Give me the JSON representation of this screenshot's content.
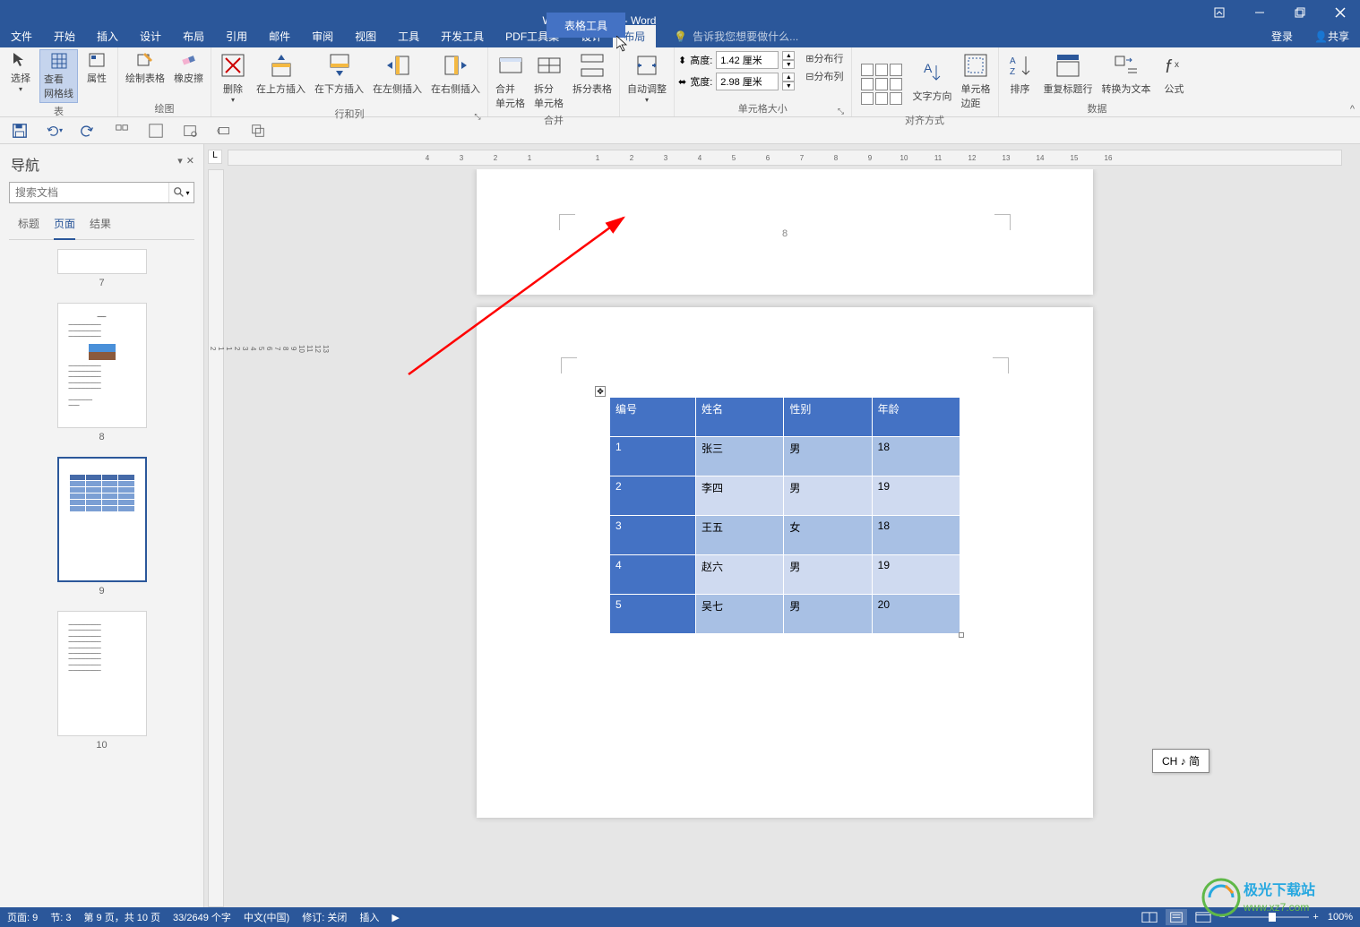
{
  "title_bar": {
    "doc_title": "Word教程2.docx - Word",
    "table_tools": "表格工具"
  },
  "window_controls": {
    "ribbon_opts": "功能区显示选项",
    "min": "最小化",
    "restore": "还原",
    "close": "关闭"
  },
  "menu": {
    "items": [
      "文件",
      "开始",
      "插入",
      "设计",
      "布局",
      "引用",
      "邮件",
      "审阅",
      "视图",
      "工具",
      "开发工具",
      "PDF工具集",
      "设计",
      "布局"
    ],
    "login": "登录",
    "share": "共享",
    "tell_me_placeholder": "告诉我您想要做什么..."
  },
  "ribbon": {
    "groups": {
      "table": {
        "label": "表",
        "select": "选择",
        "view_grid": "查看\n网格线",
        "properties": "属性"
      },
      "draw": {
        "label": "绘图",
        "draw_table": "绘制表格",
        "eraser": "橡皮擦"
      },
      "rows_cols": {
        "label": "行和列",
        "delete": "删除",
        "insert_above": "在上方插入",
        "insert_below": "在下方插入",
        "insert_left": "在左侧插入",
        "insert_right": "在右侧插入"
      },
      "merge": {
        "label": "合并",
        "merge_cells": "合并\n单元格",
        "split_cells": "拆分\n单元格",
        "split_table": "拆分表格"
      },
      "autofit": {
        "label": "",
        "autofit": "自动调整"
      },
      "cell_size": {
        "label": "单元格大小",
        "height": "高度:",
        "width": "宽度:",
        "height_val": "1.42 厘米",
        "width_val": "2.98 厘米",
        "dist_rows": "分布行",
        "dist_cols": "分布列"
      },
      "alignment": {
        "label": "对齐方式",
        "text_dir": "文字方向",
        "cell_margins": "单元格\n边距"
      },
      "data": {
        "label": "数据",
        "sort": "排序",
        "repeat_header": "重复标题行",
        "convert": "转换为文本",
        "formula": "公式"
      }
    },
    "collapse": "^"
  },
  "qat": {
    "save": "保存",
    "undo": "撤销",
    "redo": "重做"
  },
  "nav": {
    "title": "导航",
    "search_placeholder": "搜索文档",
    "tabs": [
      "标题",
      "页面",
      "结果"
    ],
    "pages": [
      "7",
      "8",
      "9",
      "10"
    ]
  },
  "hruler_marks": [
    "4",
    "3",
    "2",
    "1",
    "",
    "1",
    "2",
    "3",
    "4",
    "5",
    "6",
    "7",
    "8",
    "9",
    "10",
    "11",
    "12",
    "13",
    "14",
    "15",
    "16"
  ],
  "vruler_marks": [
    "2",
    "1",
    "",
    "1",
    "2",
    "3",
    "4",
    "5",
    "6",
    "7",
    "8",
    "9",
    "10",
    "11",
    "12",
    "13"
  ],
  "document": {
    "page_number": "8",
    "table_handle": "✥",
    "table": {
      "headers": [
        "编号",
        "姓名",
        "性别",
        "年龄"
      ],
      "rows": [
        [
          "1",
          "张三",
          "男",
          "18"
        ],
        [
          "2",
          "李四",
          "男",
          "19"
        ],
        [
          "3",
          "王五",
          "女",
          "18"
        ],
        [
          "4",
          "赵六",
          "男",
          "19"
        ],
        [
          "5",
          "吴七",
          "男",
          "20"
        ]
      ]
    }
  },
  "status": {
    "page": "页面: 9",
    "section": "节: 3",
    "page_of": "第 9 页，共 10 页",
    "words": "33/2649 个字",
    "lang": "中文(中国)",
    "revision": "修订: 关闭",
    "insert": "插入",
    "zoom": "100%"
  },
  "ime": "CH ♪ 简",
  "watermark": {
    "brand": "极光下载站",
    "url": "www.xz7.com"
  }
}
